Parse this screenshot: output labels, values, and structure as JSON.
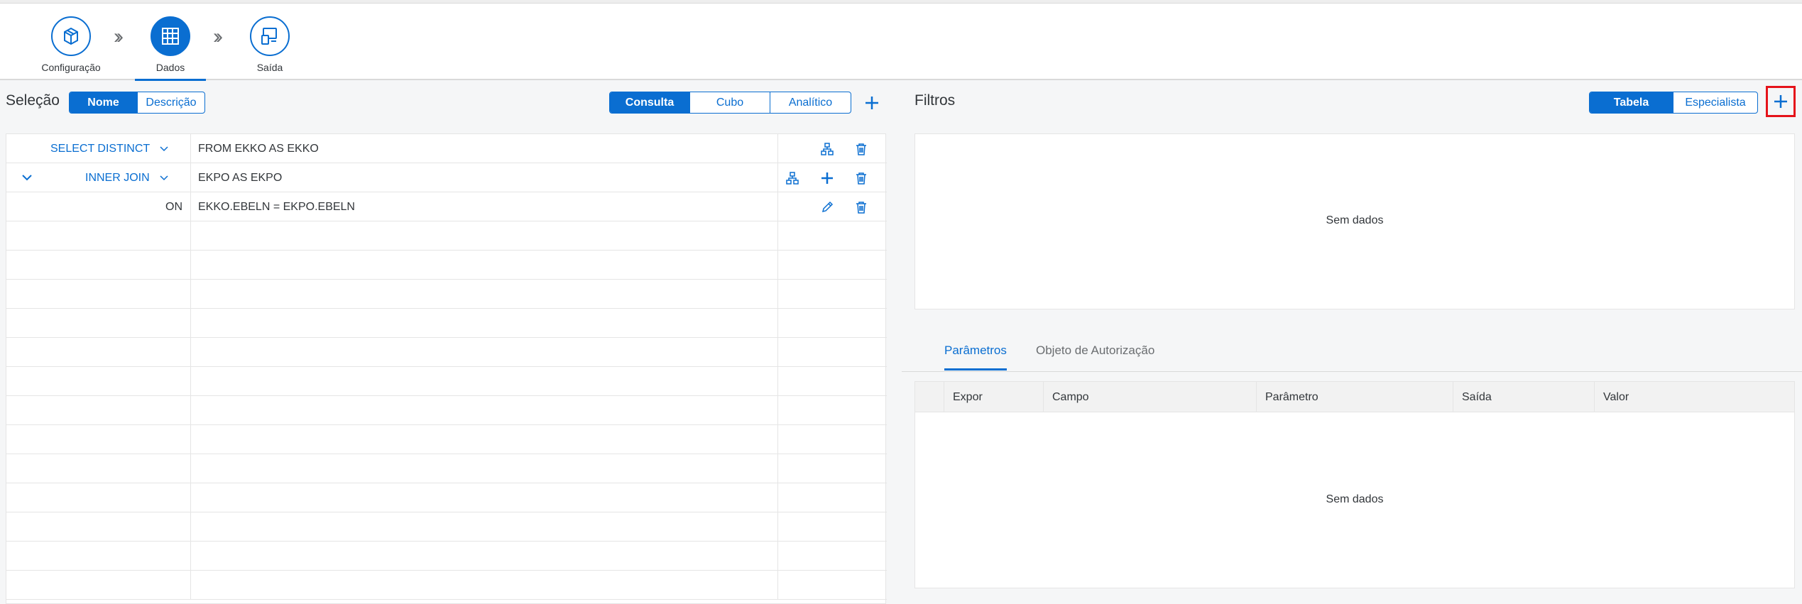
{
  "wizard": {
    "steps": [
      {
        "label": "Configuração",
        "icon": "package-icon"
      },
      {
        "label": "Dados",
        "icon": "table-grid-icon"
      },
      {
        "label": "Saída",
        "icon": "devices-icon"
      }
    ],
    "active_step": "Dados"
  },
  "selection": {
    "title": "Seleção",
    "display_toggle": [
      "Nome",
      "Descrição"
    ],
    "display_selected": "Nome",
    "mode_toggle": [
      "Consulta",
      "Cubo",
      "Analítico"
    ],
    "mode_selected": "Consulta",
    "rows": [
      {
        "keyword": "SELECT DISTINCT",
        "value": "FROM EKKO AS EKKO",
        "actions": [
          "hierarchy-icon",
          "delete-icon"
        ]
      },
      {
        "keyword": "INNER JOIN",
        "value": "EKPO AS EKPO",
        "actions": [
          "hierarchy-icon",
          "add-icon",
          "delete-icon"
        ],
        "expanded": true
      },
      {
        "keyword": "ON",
        "value": "EKKO.EBELN = EKPO.EBELN",
        "actions": [
          "edit-icon",
          "delete-icon"
        ]
      }
    ]
  },
  "filters": {
    "title": "Filtros",
    "view_toggle": [
      "Tabela",
      "Especialista"
    ],
    "view_selected": "Tabela",
    "empty_text": "Sem dados"
  },
  "bottom_tabs": [
    {
      "label": "Parâmetros",
      "selected": true
    },
    {
      "label": "Objeto de Autorização",
      "selected": false
    }
  ],
  "params_table": {
    "columns": [
      "Expor",
      "Campo",
      "Parâmetro",
      "Saída",
      "Valor"
    ],
    "empty_text": "Sem dados"
  },
  "colors": {
    "accent": "#0a6ed1",
    "highlight": "#e5131a"
  }
}
